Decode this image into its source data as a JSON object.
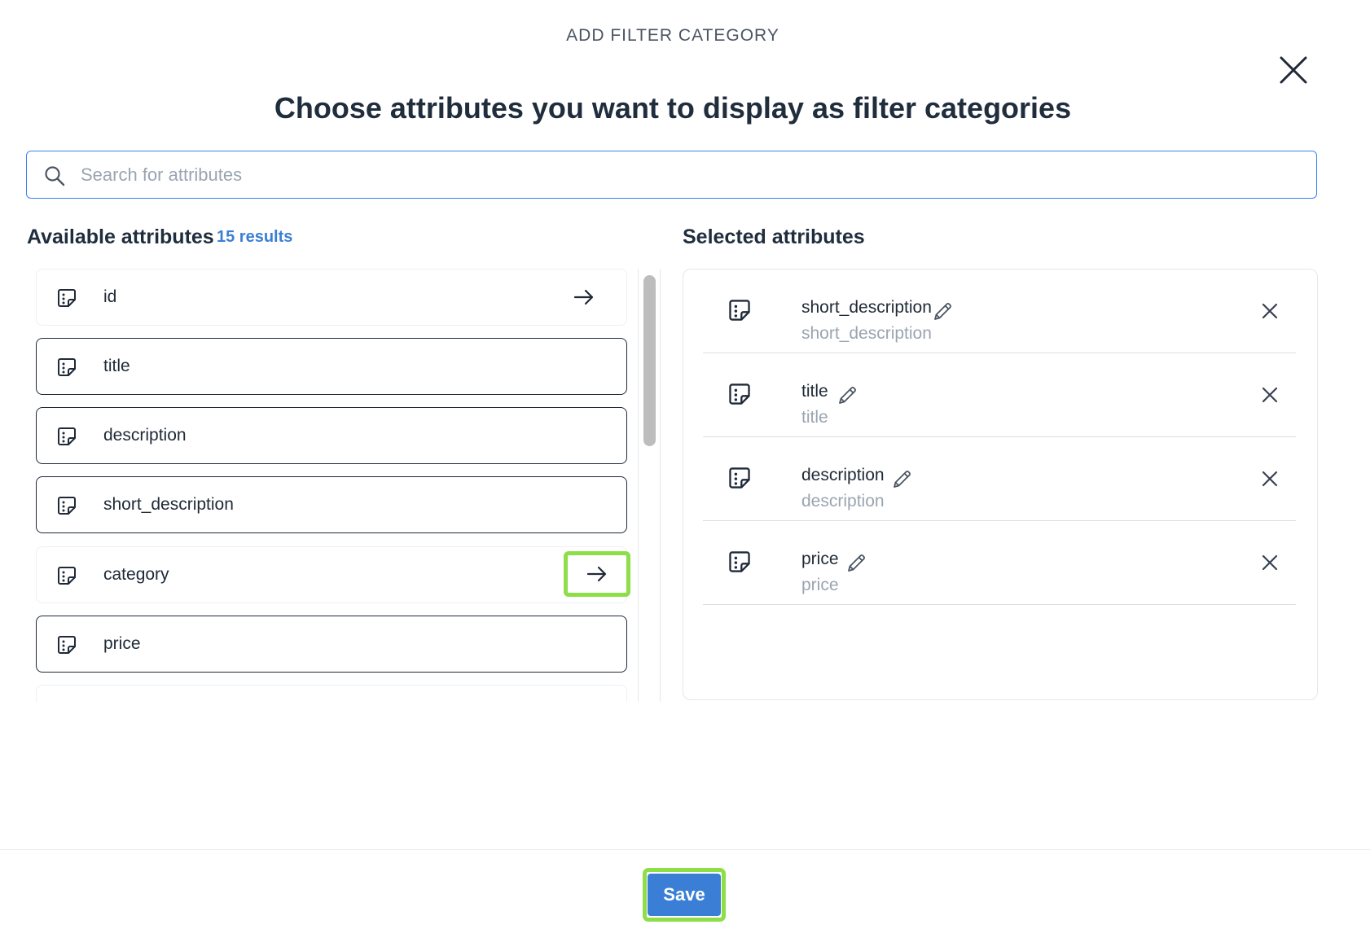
{
  "modal": {
    "header": "ADD FILTER CATEGORY",
    "title": "Choose attributes you want to display as filter categories"
  },
  "search": {
    "placeholder": "Search for attributes",
    "value": ""
  },
  "available": {
    "heading": "Available attributes",
    "count": "15 results",
    "items": [
      {
        "label": "id",
        "selected": false
      },
      {
        "label": "title",
        "selected": true
      },
      {
        "label": "description",
        "selected": true
      },
      {
        "label": "short_description",
        "selected": true
      },
      {
        "label": "category",
        "selected": false
      },
      {
        "label": "price",
        "selected": true
      }
    ]
  },
  "selected": {
    "heading": "Selected attributes",
    "items": [
      {
        "name": "short_description",
        "sub": "short_description"
      },
      {
        "name": "title",
        "sub": "title"
      },
      {
        "name": "description",
        "sub": "description"
      },
      {
        "name": "price",
        "sub": "price"
      }
    ]
  },
  "footer": {
    "save_label": "Save"
  },
  "colors": {
    "accent": "#3a7fd5",
    "highlight": "#8ede4a",
    "search_border": "#3b82f6",
    "count_text": "#3b7fd4"
  },
  "icons": {
    "close": "close-icon",
    "search": "search-icon",
    "attribute": "attribute-icon",
    "add": "arrow-right-icon",
    "edit": "pencil-icon",
    "remove": "close-icon"
  }
}
